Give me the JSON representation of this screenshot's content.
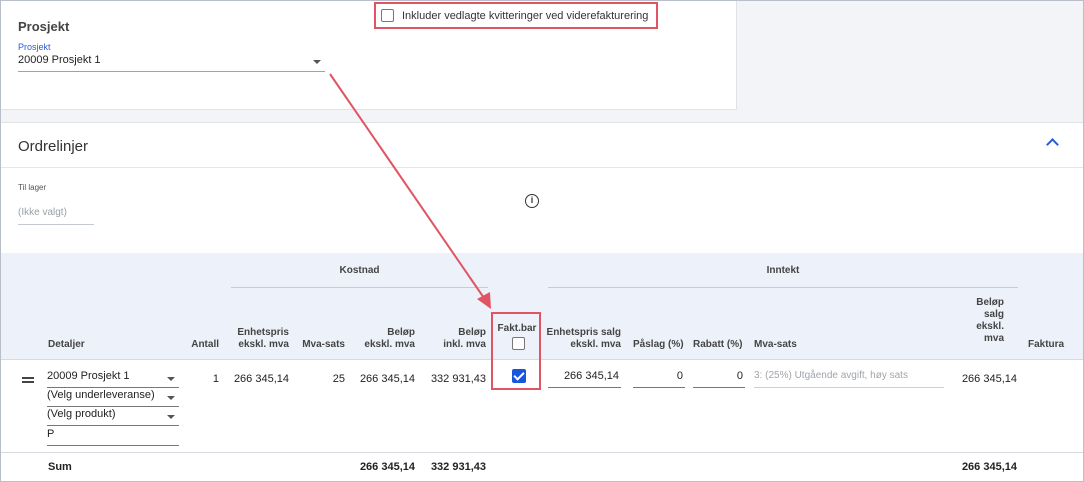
{
  "project": {
    "title": "Prosjekt",
    "select_label": "Prosjekt",
    "select_value": "20009 Prosjekt 1",
    "include_receipts_label": "Inkluder vedlagte kvitteringer ved viderefakturering"
  },
  "orderlines": {
    "title": "Ordrelinjer",
    "stock_label": "Til lager",
    "stock_value": "(Ikke valgt)",
    "groups": {
      "cost": "Kostnad",
      "income": "Inntekt"
    },
    "columns": {
      "details": "Detaljer",
      "quantity": "Antall",
      "unit_price_excl": [
        "Enhetspris",
        "ekskl. mva"
      ],
      "vat_rate": "Mva-sats",
      "amount_excl": [
        "Beløp",
        "ekskl. mva"
      ],
      "amount_incl": [
        "Beløp",
        "inkl. mva"
      ],
      "billable": "Fakt.bar",
      "sales_unit_price": [
        "Enhetspris salg",
        "ekskl. mva"
      ],
      "markup": "Påslag (%)",
      "discount": "Rabatt (%)",
      "vat": "Mva-sats",
      "sales_amount": [
        "Beløp",
        "salg",
        "ekskl.",
        "mva"
      ],
      "invoice": "Faktura"
    },
    "row": {
      "project": "20009 Prosjekt 1",
      "subdelivery": "(Velg underleveranse)",
      "product": "(Velg produkt)",
      "description": "P",
      "quantity": "1",
      "unit_price": "266 345,14",
      "vat_rate": "25",
      "amount_excl": "266 345,14",
      "amount_incl": "332 931,43",
      "billable": true,
      "sales_unit_price": "266 345,14",
      "markup": "0",
      "discount": "0",
      "vat_select": "3: (25%) Utgående avgift, høy sats",
      "sales_amount": "266 345,14"
    },
    "sum": {
      "label": "Sum",
      "amount_excl": "266 345,14",
      "amount_incl": "332 931,43",
      "sales_amount": "266 345,14"
    }
  },
  "colors": {
    "accent": "#1a56db",
    "highlight": "#e05563",
    "header_bg": "#edf2fa"
  }
}
